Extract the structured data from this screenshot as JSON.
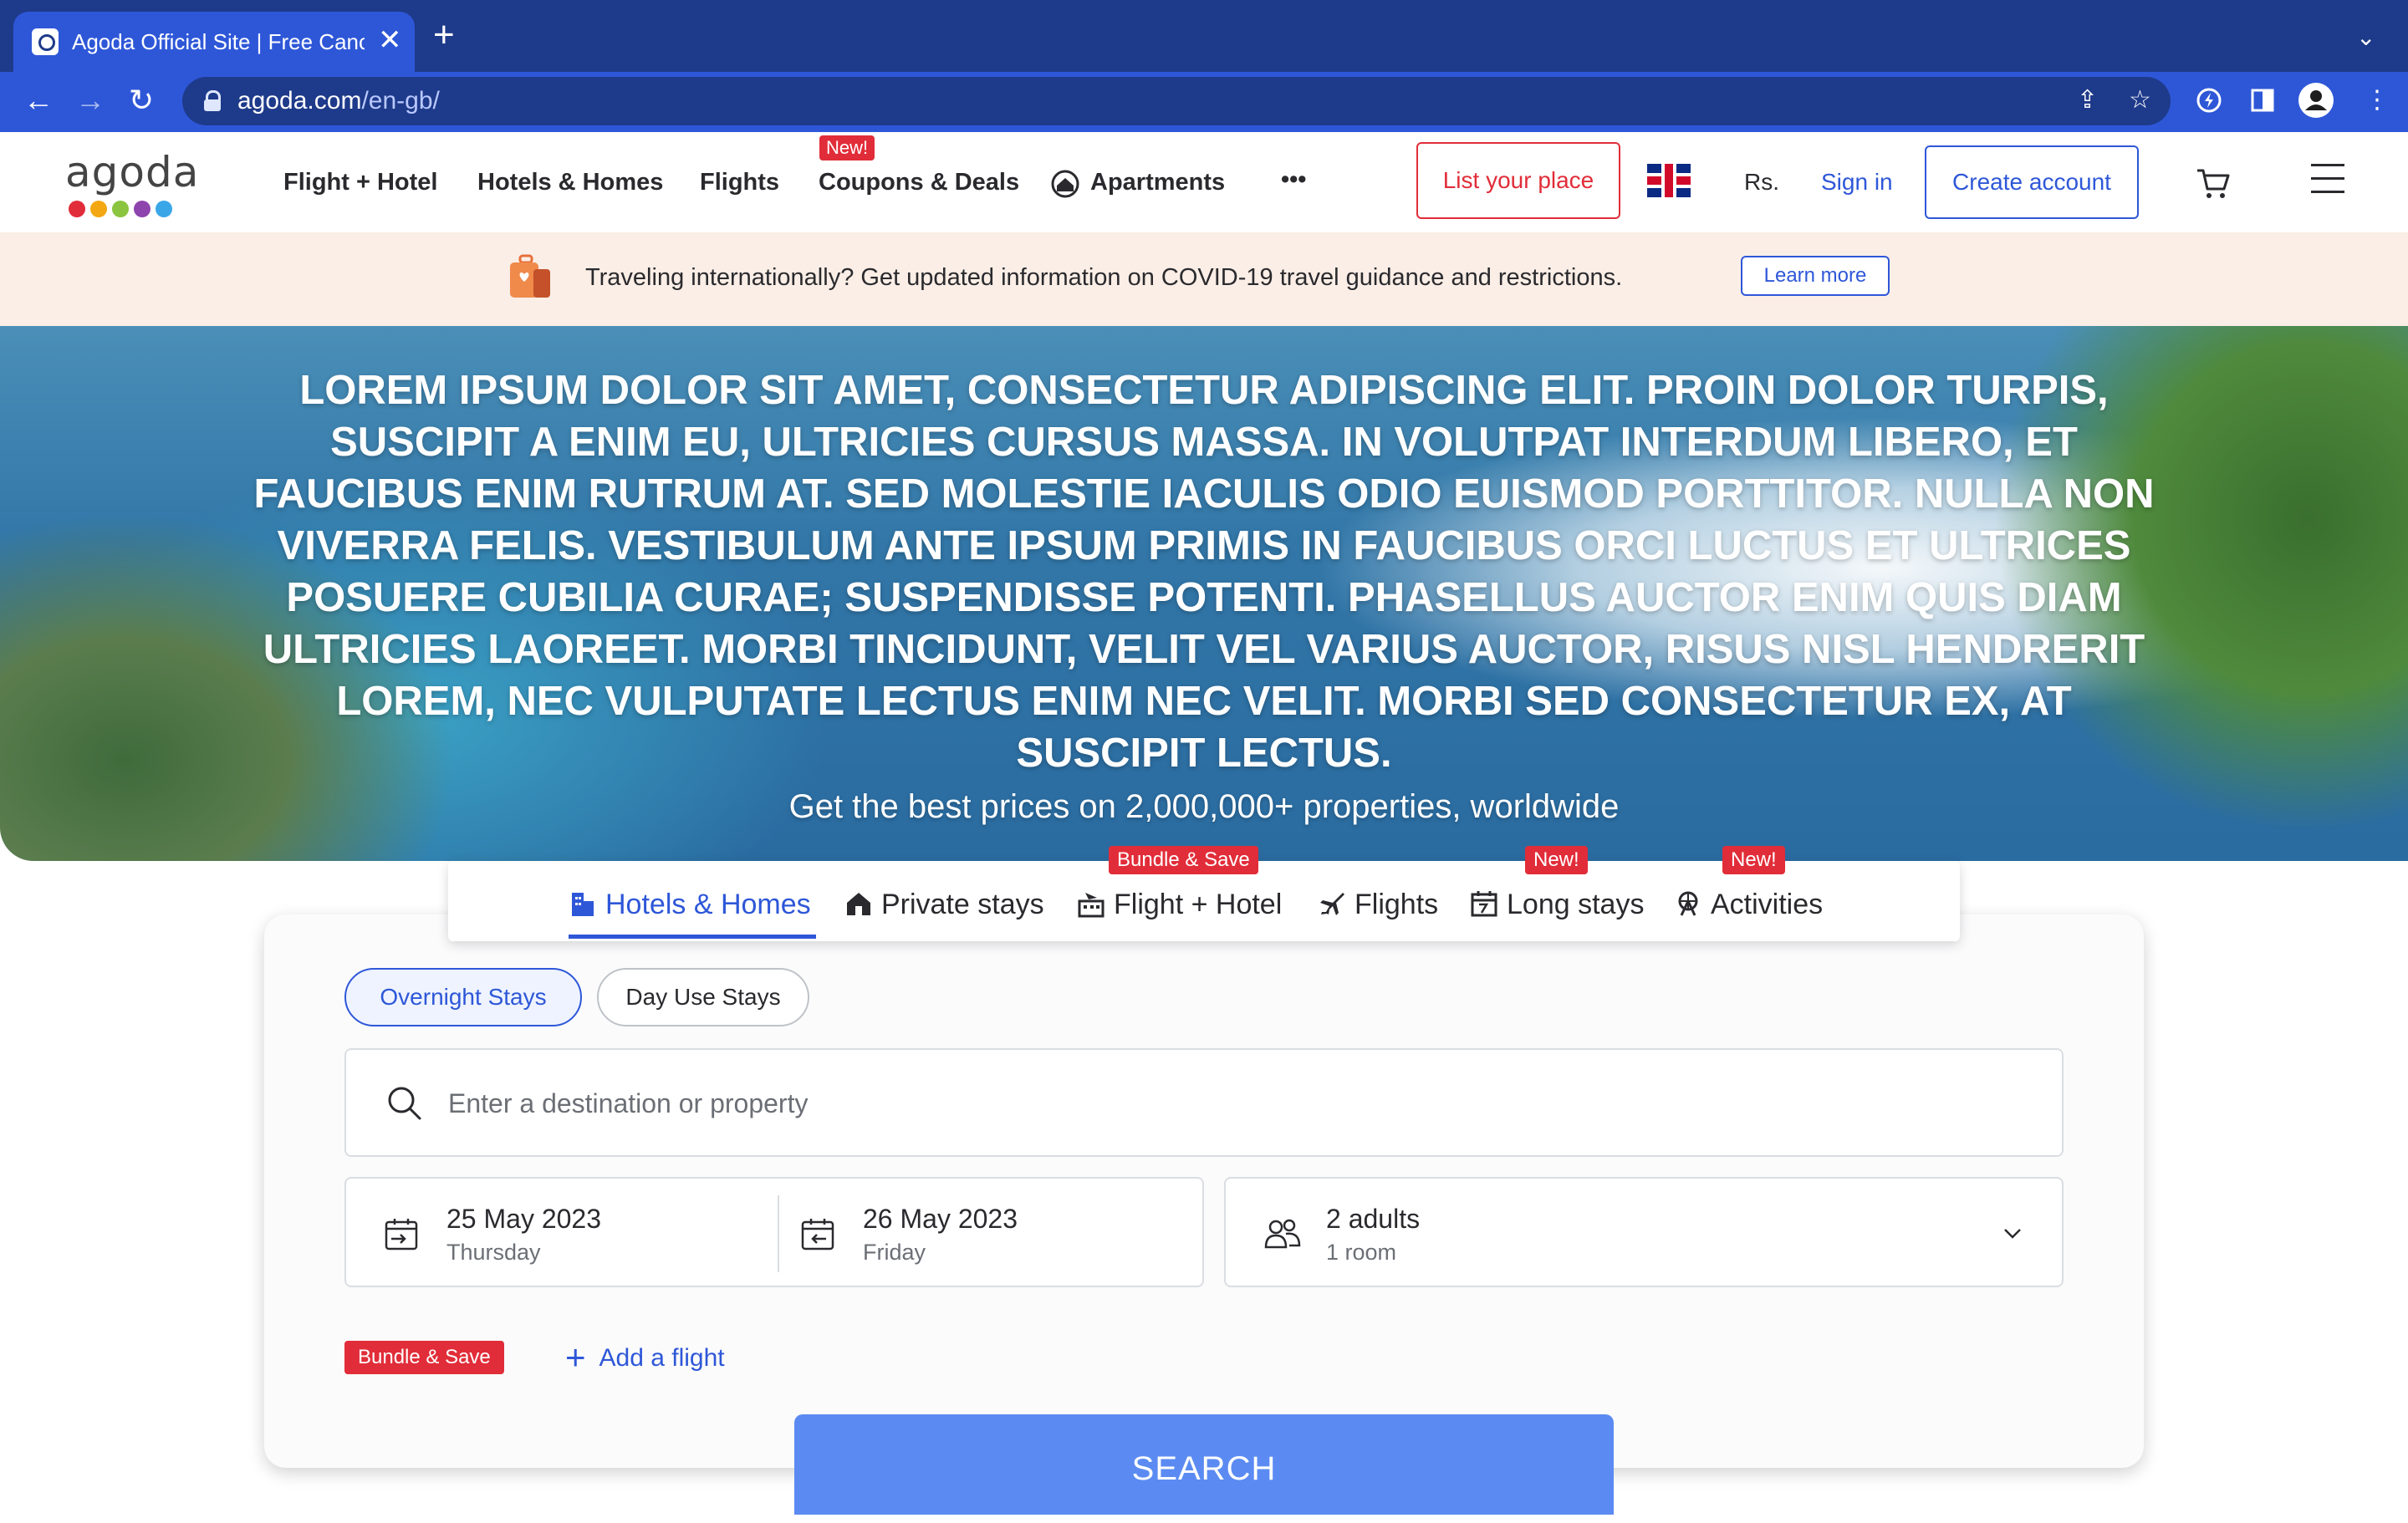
{
  "browser": {
    "tab_title": "Agoda Official Site | Free Cancellation",
    "tab_close": "✕",
    "new_tab": "+",
    "tab_menu": "⌄",
    "url_host": "agoda.com",
    "url_path": "/en-gb/",
    "back": "←",
    "forward": "→",
    "reload": "↻",
    "share": "⇪",
    "star": "☆",
    "more": "⋮"
  },
  "header": {
    "logo_text": "agoda",
    "logo_dot_colors": [
      "#e12d39",
      "#f3a712",
      "#8bc53f",
      "#8e44ad",
      "#3aa6e8"
    ],
    "nav": [
      {
        "label": "Flight + Hotel"
      },
      {
        "label": "Hotels & Homes"
      },
      {
        "label": "Flights"
      },
      {
        "label": "Coupons & Deals",
        "badge": "New!"
      },
      {
        "label": "Apartments"
      }
    ],
    "more_label": "•••",
    "list_place": "List your place",
    "currency": "Rs.",
    "sign_in": "Sign in",
    "create_account": "Create account"
  },
  "covid": {
    "text": "Traveling internationally? Get updated information on COVID-19 travel guidance and restrictions.",
    "learn_more": "Learn more"
  },
  "hero": {
    "headline": "LOREM IPSUM DOLOR SIT AMET, CONSECTETUR ADIPISCING ELIT. PROIN DOLOR TURPIS, SUSCIPIT A ENIM EU, ULTRICIES CURSUS MASSA. IN VOLUTPAT INTERDUM LIBERO, ET FAUCIBUS ENIM RUTRUM AT. SED MOLESTIE IACULIS ODIO EUISMOD PORTTITOR. NULLA NON VIVERRA FELIS. VESTIBULUM ANTE IPSUM PRIMIS IN FAUCIBUS ORCI LUCTUS ET ULTRICES POSUERE CUBILIA CURAE; SUSPENDISSE POTENTI. PHASELLUS AUCTOR ENIM QUIS DIAM ULTRICIES LAOREET. MORBI TINCIDUNT, VELIT VEL VARIUS AUCTOR, RISUS NISL HENDRERIT LOREM, NEC VULPUTATE LECTUS ENIM NEC VELIT. MORBI SED CONSECTETUR EX, AT SUSCIPIT LECTUS.",
    "subheadline": "Get the best prices on 2,000,000+ properties, worldwide"
  },
  "product_tabs": [
    {
      "label": "Hotels & Homes",
      "active": true
    },
    {
      "label": "Private stays"
    },
    {
      "label": "Flight + Hotel",
      "badge": "Bundle & Save"
    },
    {
      "label": "Flights"
    },
    {
      "label": "Long stays",
      "badge": "New!"
    },
    {
      "label": "Activities",
      "badge": "New!"
    }
  ],
  "search": {
    "overnight": "Overnight Stays",
    "day_use": "Day Use Stays",
    "destination_placeholder": "Enter a destination or property",
    "checkin_date": "25 May 2023",
    "checkin_day": "Thursday",
    "checkout_date": "26 May 2023",
    "checkout_day": "Friday",
    "guests": "2 adults",
    "rooms": "1 room",
    "bundle_badge": "Bundle & Save",
    "add_flight": "Add a flight",
    "add_flight_plus": "+",
    "search_button": "SEARCH"
  },
  "colors": {
    "brand_blue": "#2e57d8",
    "badge_red": "#e12d39",
    "search_button": "#5b8bf2",
    "chrome_dark": "#1e3a8a"
  }
}
